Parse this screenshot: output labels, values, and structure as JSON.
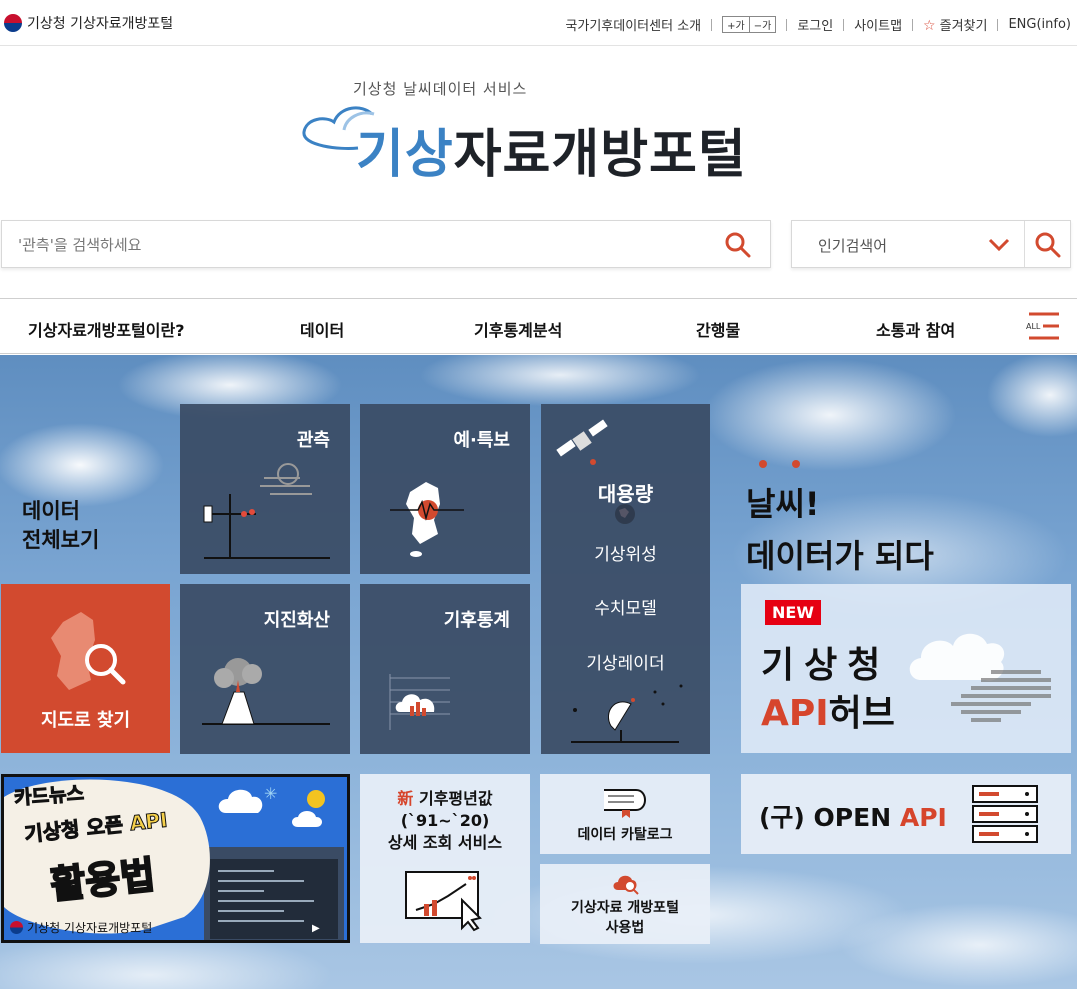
{
  "header": {
    "brand": "기상청 기상자료개방포털",
    "util_links": [
      "국가기후데이터센터 소개",
      "로그인",
      "사이트맵",
      "즐겨찾기",
      "ENG(info)"
    ],
    "font_plus": "+가",
    "font_minus": "−가"
  },
  "logo": {
    "subtitle": "기상청 날씨데이터 서비스",
    "title_blue": "기상",
    "title_dark": "자료개방포털"
  },
  "search": {
    "placeholder": "'관측'을 검색하세요",
    "popular_label": "인기검색어"
  },
  "nav": {
    "items": [
      "기상자료개방포털이란?",
      "데이터",
      "기후통계분석",
      "간행물",
      "소통과 참여"
    ],
    "all_label": "ALL"
  },
  "hero": {
    "all_data_line1": "데이터",
    "all_data_line2": "전체보기",
    "tiles": {
      "observation": "관측",
      "forecast": "예·특보",
      "earthquake": "지진화산",
      "climate": "기후통계",
      "bigdata_title": "대용량",
      "satellite": "기상위성",
      "model": "수치모델",
      "radar": "기상레이더"
    },
    "map_find": "지도로 찾기",
    "slogan_line1": "날씨!",
    "slogan_line2": "데이터가 되다",
    "apihub": {
      "badge": "NEW",
      "line1": "기상청",
      "line2_red": "API",
      "line2_dark": "허브"
    },
    "open_api": {
      "prefix": "(구) OPEN ",
      "red": "API"
    },
    "cardnews": {
      "line1": "카드뉴스",
      "line2": "기상청 오픈 API",
      "line3": "활용법",
      "footer": "기상청 기상자료개방포털"
    },
    "normal": {
      "new_char": "新",
      "line1": "기후평년값",
      "line2": "(`91~`20)",
      "line3": "상세 조회 서비스"
    },
    "catalog": "데이터 카탈로그",
    "usage_line1": "기상자료 개방포털",
    "usage_line2": "사용법"
  },
  "colors": {
    "accent_red": "#d24a2f",
    "logo_blue": "#3b82c4",
    "tile_navy": "#3a4b64"
  }
}
